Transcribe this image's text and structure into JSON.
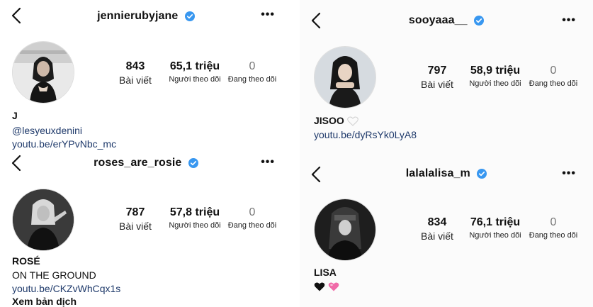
{
  "common": {
    "posts_label": "Bài viết",
    "followers_label": "Người theo dõi",
    "following_label": "Đang theo dõi",
    "more_label": "•••"
  },
  "profiles": [
    {
      "username": "jennierubyjane",
      "posts": "843",
      "followers": "65,1 triệu",
      "following": "0",
      "bio_name": "J",
      "mention": "@lesyeuxdenini",
      "link": "youtu.be/erYPvNbc_mc"
    },
    {
      "username": "roses_are_rosie",
      "posts": "787",
      "followers": "57,8 triệu",
      "following": "0",
      "bio_name": "ROSÉ",
      "bio_line": "ON THE GROUND",
      "link": "youtu.be/CKZvWhCqx1s",
      "translate": "Xem bản dịch"
    },
    {
      "username": "sooyaaa__",
      "posts": "797",
      "followers": "58,9 triệu",
      "following": "0",
      "bio_name": "JISOO",
      "link": "youtu.be/dyRsYk0LyA8"
    },
    {
      "username": "lalalalisa_m",
      "posts": "834",
      "followers": "76,1 triệu",
      "following": "0",
      "bio_name": "LISA"
    }
  ],
  "colors": {
    "verified": "#3897f0",
    "link": "#1f3a6b"
  },
  "icons": [
    "back-arrow-icon",
    "verified-badge-icon",
    "more-options-icon",
    "white-heart-emoji",
    "black-heart-emoji",
    "pink-heart-emoji"
  ]
}
